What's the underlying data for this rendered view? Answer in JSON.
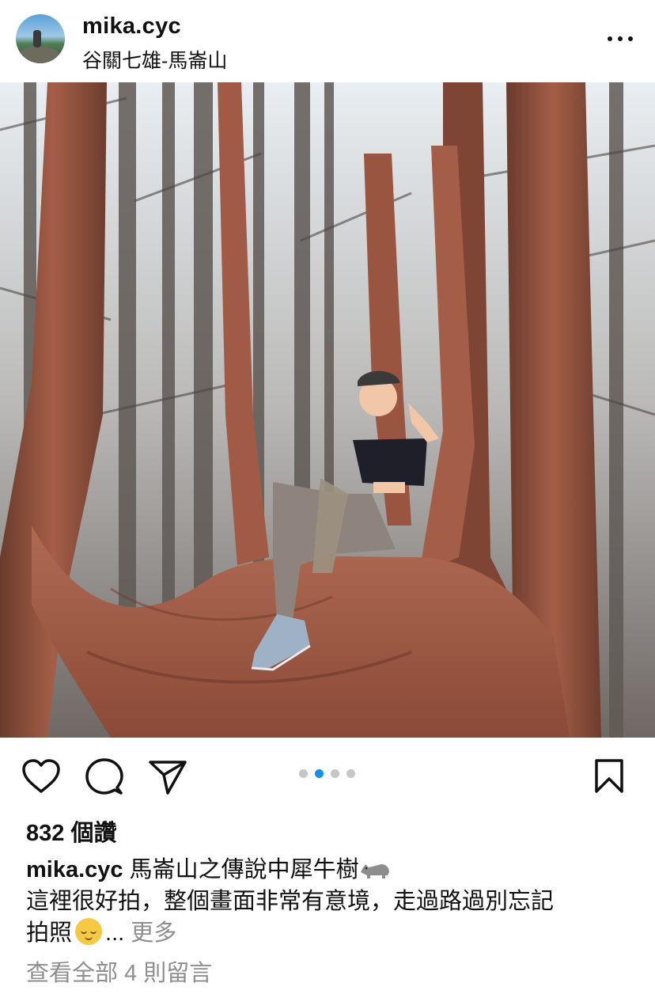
{
  "post": {
    "username": "mika.cyc",
    "location": "谷關七雄-馬崙山",
    "likes": "832 個讚",
    "caption_line1": "馬崙山之傳說中犀牛樹",
    "caption_line2": "這裡很好拍，整個畫面非常有意境，走過路過別忘記",
    "caption_line3": "拍照",
    "ellipsis": "...",
    "more_label": "更多",
    "view_comments": "查看全部 4 則留言"
  },
  "carousel": {
    "total": 4,
    "current": 2
  },
  "icons": {
    "menu": "more-dots-icon",
    "like": "heart-icon",
    "comment": "comment-bubble-icon",
    "share": "paper-plane-icon",
    "save": "bookmark-icon",
    "emoji1": "rhino-emoji",
    "emoji2": "relieved-face-emoji"
  },
  "colors": {
    "accent": "#1a8fe8",
    "muted": "#8e8e8e",
    "text": "#111111"
  }
}
